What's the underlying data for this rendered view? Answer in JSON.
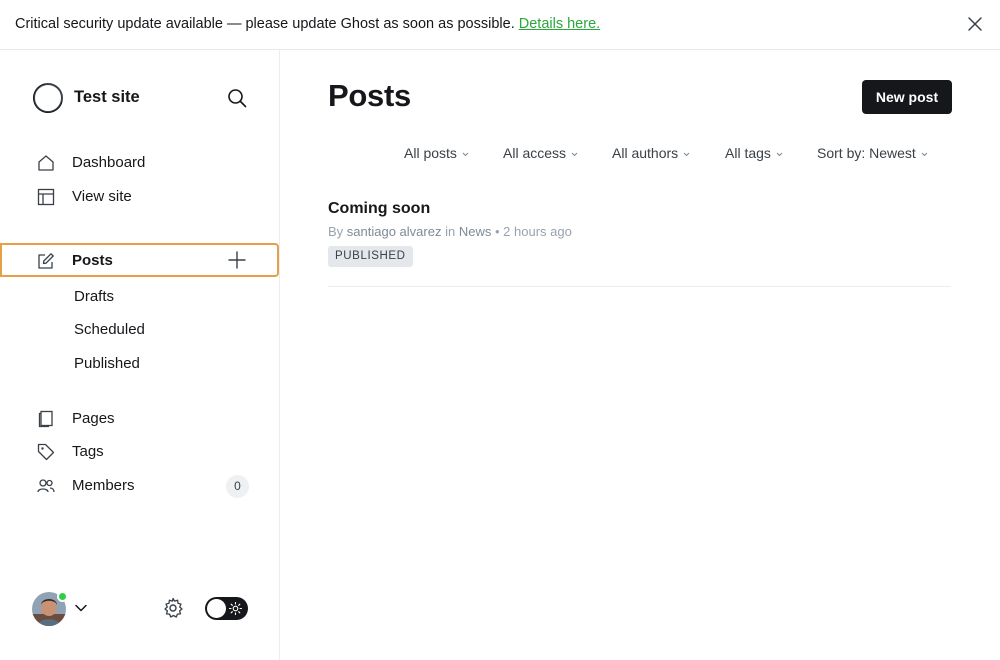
{
  "banner": {
    "message": "Critical security update available — please update Ghost as soon as possible.",
    "link_label": "Details here."
  },
  "sidebar": {
    "site_title": "Test site",
    "top_items": [
      {
        "label": "Dashboard",
        "icon": "home-icon"
      },
      {
        "label": "View site",
        "icon": "layout-icon"
      }
    ],
    "posts": {
      "label": "Posts",
      "icon": "edit-icon",
      "sub_items": [
        "Drafts",
        "Scheduled",
        "Published"
      ]
    },
    "bottom_items": [
      {
        "label": "Pages",
        "icon": "page-icon"
      },
      {
        "label": "Tags",
        "icon": "tag-icon"
      },
      {
        "label": "Members",
        "icon": "members-icon",
        "count": "0"
      }
    ]
  },
  "main": {
    "title": "Posts",
    "new_post_label": "New post",
    "filters": [
      "All posts",
      "All access",
      "All authors",
      "All tags",
      "Sort by: Newest"
    ],
    "posts": [
      {
        "title": "Coming soon",
        "by": "By",
        "author": "santiago alvarez",
        "in": "in",
        "tag": "News",
        "separator": "•",
        "time": "2 hours ago",
        "status": "PUBLISHED"
      }
    ]
  },
  "colors": {
    "accent_border": "#e5a145",
    "link_green": "#29a83a",
    "online_dot": "#30cf43",
    "button_dark": "#15171a"
  }
}
